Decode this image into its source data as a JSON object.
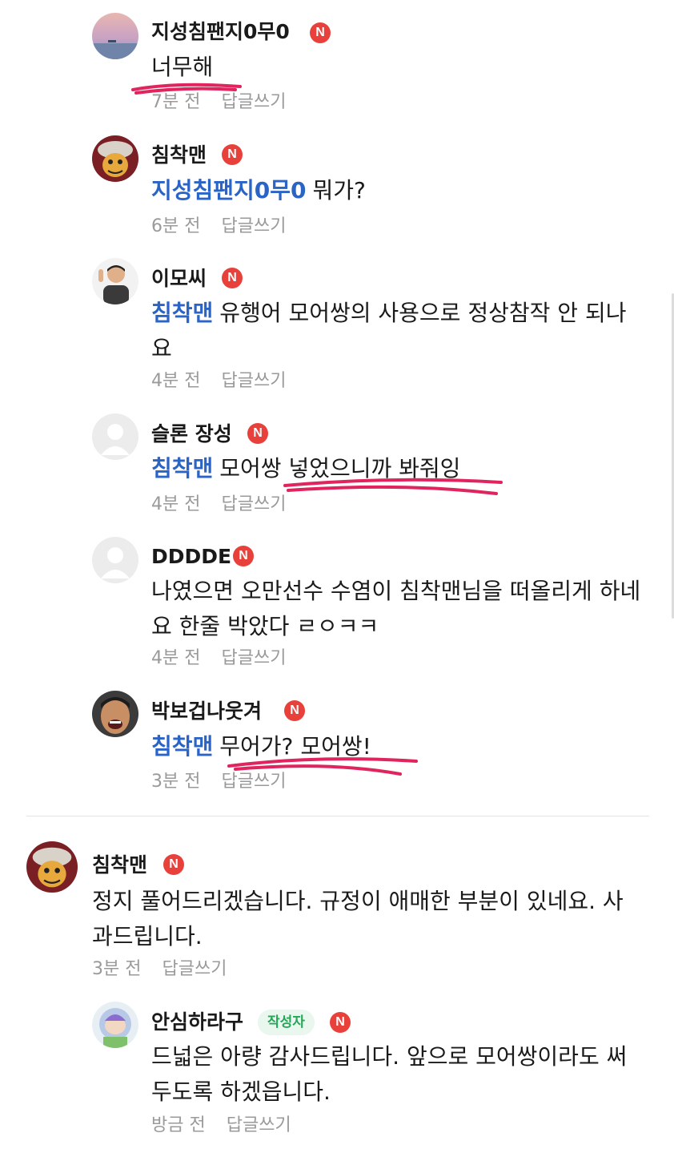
{
  "comments": [
    {
      "nickname": "지성침팬지0무0",
      "badge": "N",
      "mention": "",
      "text": "너무해",
      "time": "7분 전",
      "reply": "답글쓰기"
    },
    {
      "nickname": "침착맨",
      "badge": "N",
      "mention": "지성침팬지0무0",
      "text": "뭐가?",
      "time": "6분 전",
      "reply": "답글쓰기"
    },
    {
      "nickname": "이모씨",
      "badge": "N",
      "mention": "침착맨",
      "text": "유행어 모어쌍의 사용으로 정상참작 안 되나요",
      "time": "4분 전",
      "reply": "답글쓰기"
    },
    {
      "nickname": "슬론 장성",
      "badge": "N",
      "mention": "침착맨",
      "text": "모어쌍 넣었으니까 봐줘잉",
      "time": "4분 전",
      "reply": "답글쓰기"
    },
    {
      "nickname": "DDDDE",
      "badge": "N",
      "mention": "",
      "text": "나였으면 오만선수 수염이 침착맨님을 떠올리게 하네요 한줄 박았다 ㄹㅇㅋㅋ",
      "time": "4분 전",
      "reply": "답글쓰기"
    },
    {
      "nickname": "박보겁나웃겨",
      "badge": "N",
      "mention": "침착맨",
      "text": "무어가? 모어쌍!",
      "time": "3분 전",
      "reply": "답글쓰기"
    },
    {
      "nickname": "침착맨",
      "badge": "N",
      "mention": "",
      "text": "정지 풀어드리겠습니다. 규정이 애매한 부분이 있네요. 사과드립니다.",
      "time": "3분 전",
      "reply": "답글쓰기"
    },
    {
      "nickname": "안심하라구",
      "badge": "N",
      "author_label": "작성자",
      "mention": "",
      "text": "드넓은 아량 감사드립니다. 앞으로 모어쌍이라도 써두도록 하겠읍니다.",
      "time": "방금 전",
      "reply": "답글쓰기"
    }
  ],
  "colors": {
    "mention": "#2b64c7",
    "badge": "#e8413b",
    "highlight": "#e0245e",
    "author_badge": "#23a857"
  }
}
